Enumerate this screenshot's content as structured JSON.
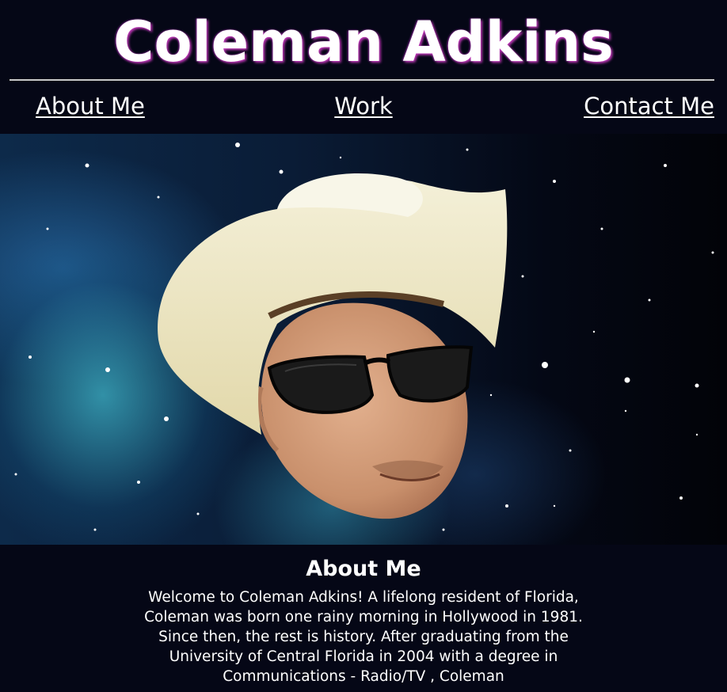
{
  "site": {
    "title": "Coleman Adkins"
  },
  "nav": {
    "about_label": "About Me",
    "work_label": "Work",
    "contact_label": "Contact Me"
  },
  "about": {
    "heading": "About Me",
    "body": "Welcome to Coleman Adkins! A lifelong resident of Florida, Coleman was born one rainy morning in Hollywood in 1981. Since then, the rest is history. After graduating from the University of Central Florida in 2004 with a degree in Communications - Radio/TV , Coleman"
  },
  "colors": {
    "background": "#050716",
    "text": "#ffffff",
    "title_glow": "#c038b8",
    "rule": "#c9c9c9"
  }
}
